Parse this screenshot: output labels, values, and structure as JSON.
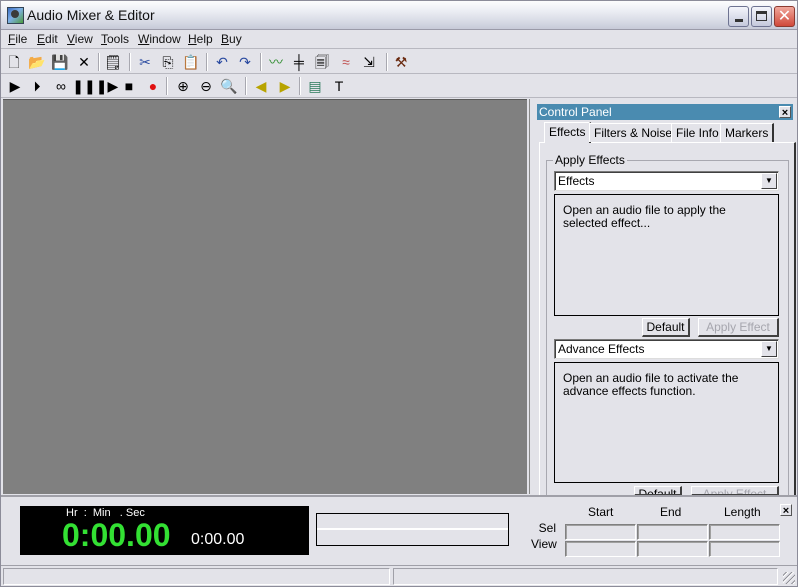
{
  "window": {
    "title": "Audio Mixer & Editor",
    "controls": {
      "minimize": "minimize",
      "maximize": "maximize",
      "close": "close"
    }
  },
  "menu": [
    {
      "label": "File",
      "accel": "F"
    },
    {
      "label": "Edit",
      "accel": "E"
    },
    {
      "label": "View",
      "accel": "V"
    },
    {
      "label": "Tools",
      "accel": "T"
    },
    {
      "label": "Window",
      "accel": "W"
    },
    {
      "label": "Help",
      "accel": "H"
    },
    {
      "label": "Buy",
      "accel": "B"
    }
  ],
  "toolbar_main": [
    {
      "name": "new-file",
      "glyph": "🗋"
    },
    {
      "name": "open-folder",
      "glyph": "📂"
    },
    {
      "name": "save",
      "glyph": "💾"
    },
    {
      "name": "close",
      "glyph": "✕"
    },
    {
      "name": "properties",
      "glyph": "🗒"
    },
    {
      "name": "cut",
      "glyph": "✂"
    },
    {
      "name": "copy",
      "glyph": "⎘"
    },
    {
      "name": "paste",
      "glyph": "📋"
    },
    {
      "name": "undo",
      "glyph": "↶"
    },
    {
      "name": "redo",
      "glyph": "↷"
    },
    {
      "name": "waveform",
      "glyph": "〰"
    },
    {
      "name": "split",
      "glyph": "╪"
    },
    {
      "name": "clipboard-file",
      "glyph": "🗐"
    },
    {
      "name": "crossfade",
      "glyph": "≈"
    },
    {
      "name": "export",
      "glyph": "⇲"
    },
    {
      "name": "tools-hammer",
      "glyph": "⚒"
    }
  ],
  "toolbar_transport": [
    {
      "name": "play",
      "glyph": "▶"
    },
    {
      "name": "play-selection",
      "glyph": "⏵"
    },
    {
      "name": "loop",
      "glyph": "∞"
    },
    {
      "name": "pause",
      "glyph": "❚❚"
    },
    {
      "name": "play-next",
      "glyph": "❚▶"
    },
    {
      "name": "stop",
      "glyph": "■"
    },
    {
      "name": "record",
      "glyph": "●"
    },
    {
      "name": "zoom-in",
      "glyph": "⊕"
    },
    {
      "name": "zoom-out",
      "glyph": "⊖"
    },
    {
      "name": "zoom-full",
      "glyph": "🔍"
    },
    {
      "name": "volume-left",
      "glyph": "◀"
    },
    {
      "name": "volume-right",
      "glyph": "▶"
    },
    {
      "name": "view-panel",
      "glyph": "▤"
    },
    {
      "name": "text-tool",
      "glyph": "T"
    }
  ],
  "control_panel": {
    "title": "Control Panel",
    "close": "×",
    "tabs": [
      "Effects",
      "Filters & Noise",
      "File Info",
      "Markers"
    ],
    "active_tab": "Effects",
    "group_label": "Apply Effects",
    "effects_combo": "Effects",
    "effects_message": "Open an audio file to apply the selected effect...",
    "advance_combo": "Advance Effects",
    "advance_message": "Open an audio file to activate the advance effects function.",
    "default_label": "Default",
    "apply_label": "Apply Effect"
  },
  "time_display": {
    "label": "Hr  :  Min   . Sec",
    "current": "0:00.00",
    "total": "0:00.00",
    "color": "#33e033"
  },
  "selection": {
    "headers": [
      "Start",
      "End",
      "Length"
    ],
    "rows": [
      {
        "label": "Sel",
        "values": [
          "",
          "",
          ""
        ]
      },
      {
        "label": "View",
        "values": [
          "",
          "",
          ""
        ]
      }
    ],
    "close": "×"
  },
  "status": {
    "pane1": "",
    "pane2": ""
  }
}
